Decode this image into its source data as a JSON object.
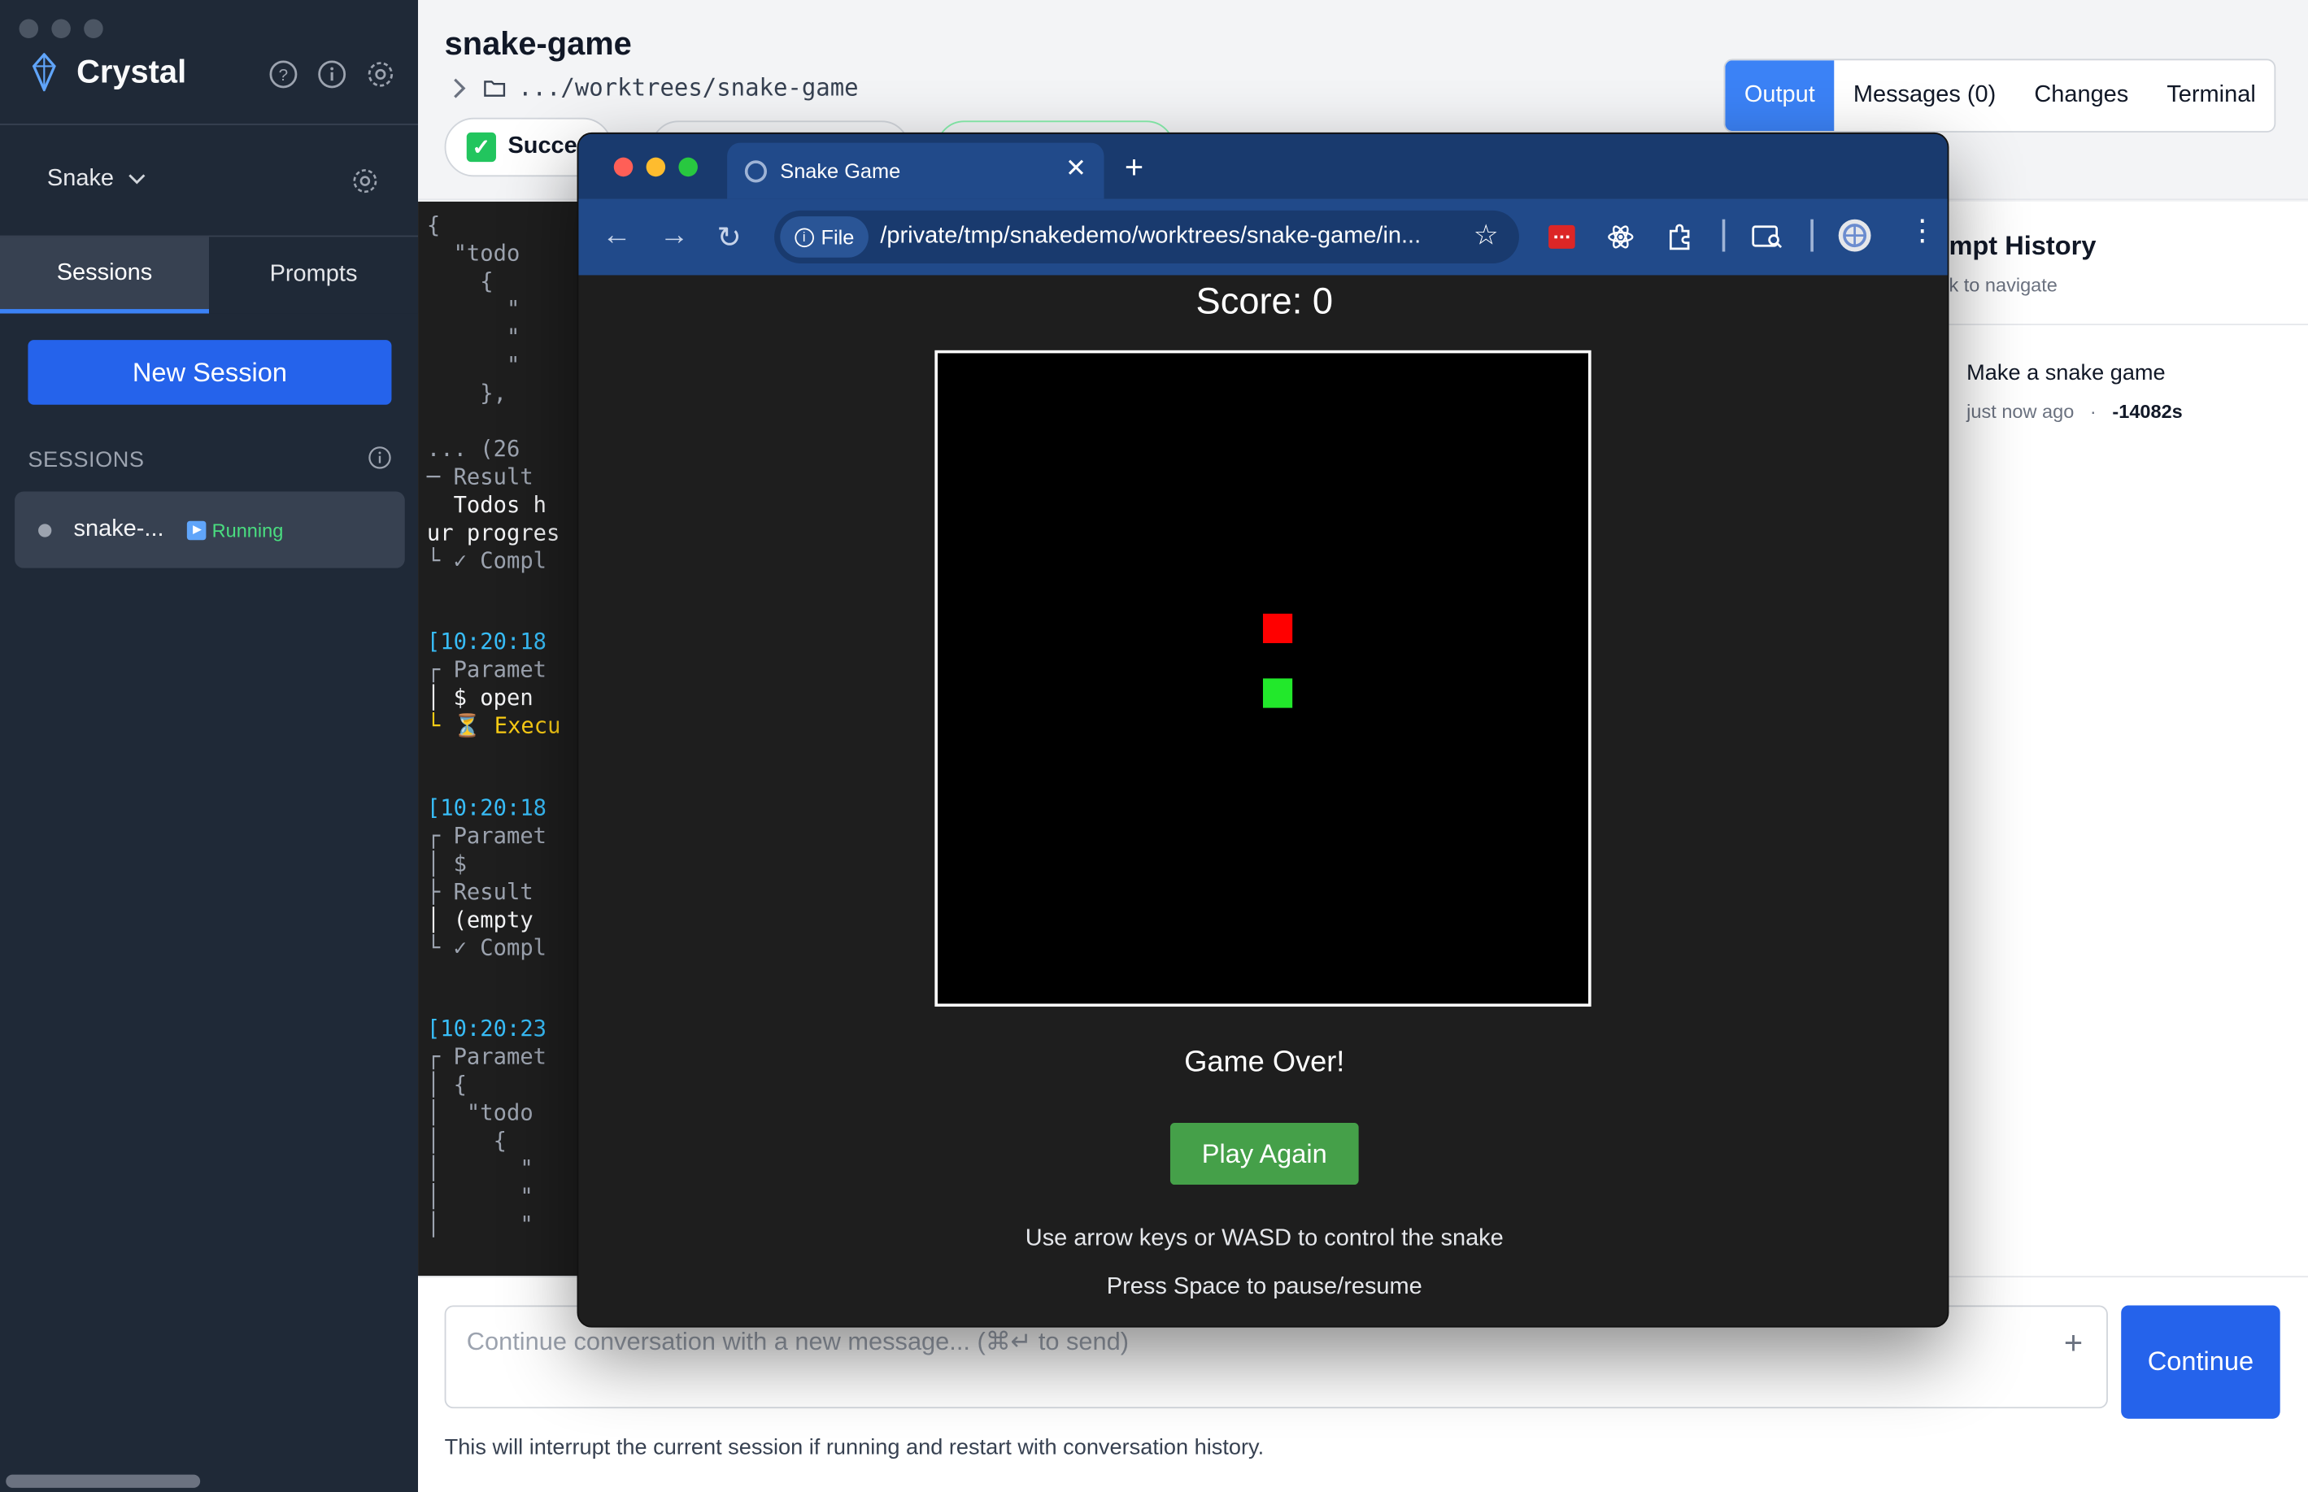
{
  "sidebar": {
    "app_name": "Crystal",
    "project": "Snake",
    "tabs": [
      "Sessions",
      "Prompts"
    ],
    "new_session": "New Session",
    "sessions_header": "SESSIONS",
    "session": {
      "name": "snake-...",
      "status": "Running"
    }
  },
  "header": {
    "title": "snake-game",
    "path": ".../worktrees/snake-game",
    "status_badge": "Succes",
    "view_tabs": [
      "Output",
      "Messages (0)",
      "Changes",
      "Terminal"
    ]
  },
  "terminal_lines": [
    "{",
    "  \"todo",
    "    {",
    "      \"",
    "      \"",
    "      \"",
    "    },",
    "... (26",
    "─ Result",
    "  Todos h",
    "ur progres",
    "└ ✓ Compl",
    "[10:20:18",
    "┌ Paramet",
    "│ $ open",
    "└ ⏳ Execu",
    "[10:20:18",
    "┌ Paramet",
    "│ $",
    "├ Result",
    "│ (empty",
    "└ ✓ Compl",
    "[10:20:23",
    "┌ Paramet",
    "│ {",
    "│  \"todo",
    "│    {",
    "│      \"",
    "│      \"",
    "│      \""
  ],
  "prompt_history": {
    "title": "mpt History",
    "subtitle": "k to navigate",
    "item": "Make a snake game",
    "time": "just now ago",
    "duration": "-14082s"
  },
  "footer": {
    "placeholder": "Continue conversation with a new message... (⌘↵ to send)",
    "continue_label": "Continue",
    "hint": "This will interrupt the current session if running and restart with conversation history."
  },
  "browser": {
    "tab_title": "Snake Game",
    "chip": "File",
    "url": "/private/tmp/snakedemo/worktrees/snake-game/in...",
    "game": {
      "score_text": "Score: 0",
      "game_over": "Game Over!",
      "play_again": "Play Again",
      "instructions": [
        "Use arrow keys or WASD to control the snake",
        "Press Space to pause/resume"
      ],
      "food_color": "#ff0000",
      "snake_color": "#22e82b"
    }
  },
  "colors": {
    "sidebar_bg": "#1f2937",
    "accent": "#2563eb",
    "running": "#4ade80",
    "browser_frame": "#214a8a"
  }
}
